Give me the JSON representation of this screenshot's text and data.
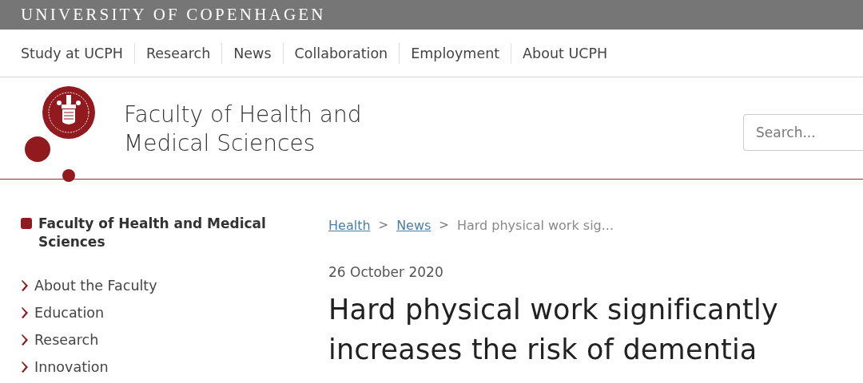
{
  "top_bar": {
    "title": "UNIVERSITY OF COPENHAGEN"
  },
  "nav": [
    {
      "label": "Study at UCPH"
    },
    {
      "label": "Research"
    },
    {
      "label": "News"
    },
    {
      "label": "Collaboration"
    },
    {
      "label": "Employment"
    },
    {
      "label": "About UCPH"
    }
  ],
  "header": {
    "faculty_title": [
      "Faculty of Health and",
      "Medical Sciences"
    ],
    "search": {
      "placeholder": "Search..."
    }
  },
  "sidebar": {
    "title": "Faculty of Health and Medical Sciences",
    "items": [
      {
        "label": "About the Faculty"
      },
      {
        "label": "Education"
      },
      {
        "label": "Research"
      },
      {
        "label": "Innovation"
      }
    ]
  },
  "breadcrumb": [
    {
      "label": "Health",
      "kind": "link"
    },
    {
      "separator": ">",
      "label": "News",
      "kind": "link"
    },
    {
      "separator": ">",
      "label": "Hard physical work sig...",
      "kind": "current"
    }
  ],
  "article": {
    "date": "26 October 2020",
    "headline": [
      "Hard physical work significantly",
      "increases the risk of dementia"
    ]
  }
}
